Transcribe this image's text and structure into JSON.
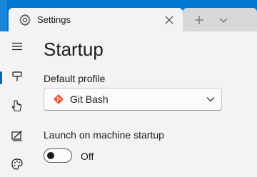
{
  "tab": {
    "title": "Settings",
    "icon": "gear-icon",
    "close_icon": "close-icon"
  },
  "tabbar": {
    "new_tab_icon": "plus-icon",
    "dropdown_icon": "chevron-down-icon"
  },
  "nav": {
    "items": [
      {
        "name": "hamburger-menu",
        "icon": "menu-icon"
      },
      {
        "name": "startup",
        "icon": "startup-icon",
        "selected": true
      },
      {
        "name": "interaction",
        "icon": "cursor-icon"
      },
      {
        "name": "appearance",
        "icon": "appearance-icon"
      },
      {
        "name": "color-schemes",
        "icon": "palette-icon"
      }
    ]
  },
  "page": {
    "title": "Startup"
  },
  "default_profile": {
    "label": "Default profile",
    "value": "Git Bash",
    "icon": "git-icon"
  },
  "launch_on_startup": {
    "label": "Launch on machine startup",
    "state_text": "Off",
    "on": false
  },
  "colors": {
    "titlebar": "#0078d4",
    "accent": "#0067c0",
    "git": "#f05133"
  }
}
